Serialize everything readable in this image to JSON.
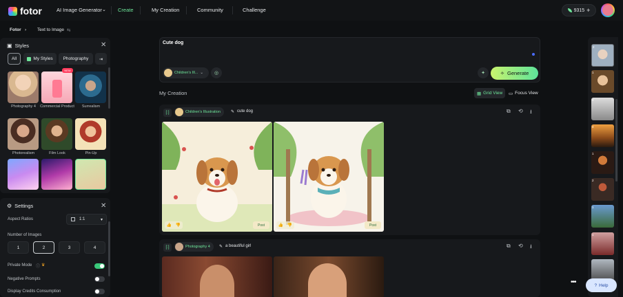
{
  "brand": {
    "name": "fotor"
  },
  "nav": {
    "items": [
      "AI Image Generator",
      "Create",
      "My Creation",
      "Community",
      "Challenge"
    ],
    "active": "Create"
  },
  "credits": {
    "count": "9315"
  },
  "breadcrumb": {
    "home": "Fotor",
    "current": "Text to Image"
  },
  "styles_panel": {
    "title": "Styles",
    "tabs": [
      "All",
      "My Styles",
      "Photography"
    ],
    "active_tab": "All",
    "items": [
      {
        "label": "Photography 4"
      },
      {
        "label": "Commercial Product",
        "badge": "NEW"
      },
      {
        "label": "Surrealism"
      },
      {
        "label": "Photorealism"
      },
      {
        "label": "Film Look"
      },
      {
        "label": "Pin-Up"
      },
      {
        "label": ""
      },
      {
        "label": ""
      },
      {
        "label": ""
      }
    ]
  },
  "settings": {
    "title": "Settings",
    "aspect_label": "Aspect Ratios",
    "aspect_value": "1:1",
    "num_images_label": "Number of Images",
    "num_options": [
      "1",
      "2",
      "3",
      "4"
    ],
    "num_selected": "2",
    "private_label": "Private Mode",
    "private_on": true,
    "negative_label": "Negative Prompts",
    "negative_on": false,
    "credits_label": "Display Credits Consumption",
    "credits_on": false
  },
  "prompt": {
    "text": "Cute dog",
    "style_chip": "Children's Ill...",
    "generate": "Generate"
  },
  "creation": {
    "title": "My Creation",
    "grid_view": "Grid View",
    "focus_view": "Focus View"
  },
  "cards": [
    {
      "style": "Children's Illustration",
      "prompt": "cute dog",
      "post": "Post"
    },
    {
      "style": "Photography 4",
      "prompt": "a beautiful girl"
    }
  ],
  "rail": {
    "numbers": [
      "2",
      "1",
      "4",
      "4",
      "1",
      "2",
      "1",
      "1"
    ]
  },
  "help": {
    "label": "Help"
  },
  "colors": {
    "accent": "#6ee69a",
    "bg": "#0f1113",
    "panel": "#17191c",
    "help_bg": "#d9e6ff"
  }
}
